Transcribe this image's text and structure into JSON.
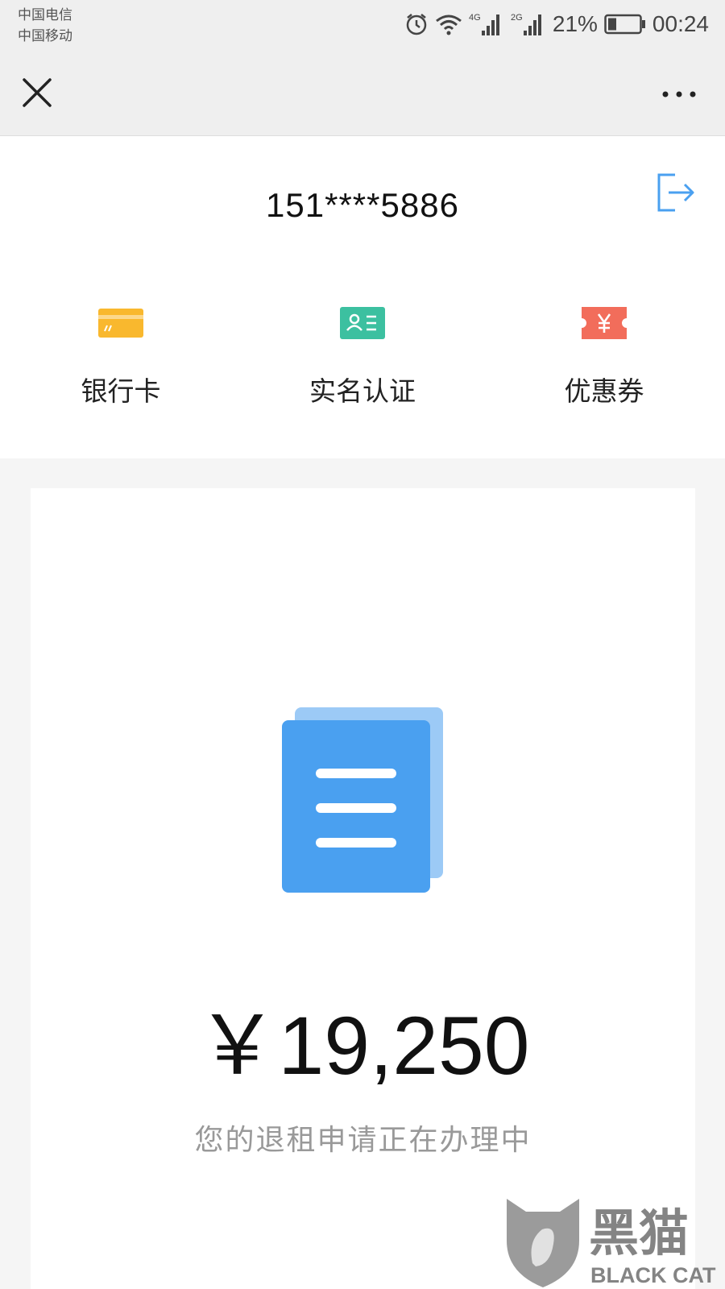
{
  "status_bar": {
    "carrier_1": "中国电信",
    "carrier_2": "中国移动",
    "network_1": "4G",
    "network_2": "2G",
    "battery_percent": "21%",
    "time": "00:24"
  },
  "nav": {
    "close_icon": "close-icon",
    "more_icon": "more-dots-icon"
  },
  "account": {
    "phone": "151****5886",
    "logout_icon": "logout-icon"
  },
  "quick_actions": [
    {
      "label": "银行卡",
      "icon": "bank-card-icon",
      "color": "#f9b82e"
    },
    {
      "label": "实名认证",
      "icon": "id-card-icon",
      "color": "#3cc0a0"
    },
    {
      "label": "优惠券",
      "icon": "coupon-icon",
      "color": "#f26d5b"
    }
  ],
  "refund": {
    "icon": "document-icon",
    "amount": "￥19,250",
    "status": "您的退租申请正在办理中"
  },
  "watermark": {
    "cn": "黑猫",
    "en": "BLACK CAT"
  },
  "colors": {
    "accent_blue": "#4aa0f0",
    "header_bg": "#efefef"
  }
}
